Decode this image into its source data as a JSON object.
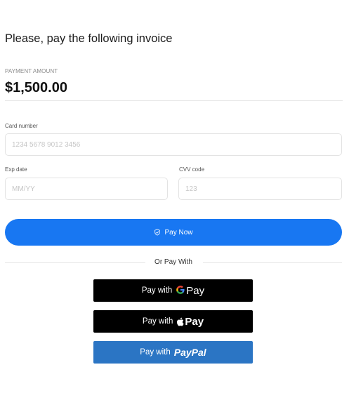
{
  "invoice": {
    "title": "Please, pay the following invoice",
    "amount_label": "PAYMENT AMOUNT",
    "amount": "$1,500.00"
  },
  "form": {
    "card_number_label": "Card number",
    "card_number_placeholder": "1234 5678 9012 3456",
    "card_number_value": "",
    "exp_label": "Exp date",
    "exp_placeholder": "MM/YY",
    "exp_value": "",
    "cvv_label": "CVV code",
    "cvv_placeholder": "123",
    "cvv_value": ""
  },
  "pay_now": {
    "label": "Pay Now",
    "icon": "shield-check-icon",
    "color": "#1877f2"
  },
  "alt_payments": {
    "separator_text": "Or Pay With",
    "google_pay": {
      "prefix": "Pay with",
      "logo_letter": "G",
      "logo_word": "Pay",
      "icon": "google-g-icon",
      "bg": "#000000"
    },
    "apple_pay": {
      "prefix": "Pay with",
      "logo_word": "Pay",
      "icon": "apple-icon",
      "bg": "#000000"
    },
    "paypal": {
      "prefix": "Pay with",
      "logo_word": "PayPal",
      "bg": "#2b75c4"
    }
  }
}
